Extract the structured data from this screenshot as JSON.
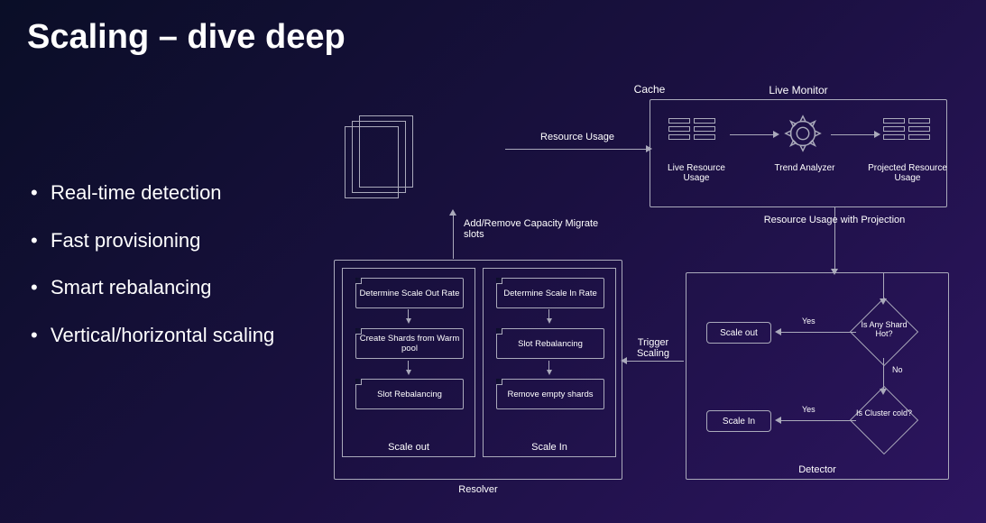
{
  "title": "Scaling – dive deep",
  "bullets": [
    "Real-time detection",
    "Fast provisioning",
    "Smart rebalancing",
    "Vertical/horizontal scaling"
  ],
  "diagram": {
    "cache": {
      "label": "Cache"
    },
    "liveMonitor": {
      "label": "Live Monitor",
      "items": {
        "liveUsage": "Live Resource Usage",
        "trend": "Trend Analyzer",
        "projected": "Projected Resource Usage"
      }
    },
    "edges": {
      "resourceUsage": "Resource Usage",
      "resourceProjection": "Resource Usage with Projection",
      "triggerScaling": "Trigger Scaling",
      "addRemove": "Add/Remove Capacity Migrate slots",
      "yes1": "Yes",
      "no": "No",
      "yes2": "Yes"
    },
    "resolver": {
      "label": "Resolver",
      "scaleOut": {
        "label": "Scale out",
        "steps": [
          "Determine Scale Out Rate",
          "Create Shards from Warm pool",
          "Slot Rebalancing"
        ]
      },
      "scaleIn": {
        "label": "Scale In",
        "steps": [
          "Determine Scale In Rate",
          "Slot Rebalancing",
          "Remove empty shards"
        ]
      }
    },
    "detector": {
      "label": "Detector",
      "decisions": {
        "hot": "Is Any Shard Hot?",
        "cold": "Is Cluster cold?"
      },
      "actions": {
        "scaleOut": "Scale out",
        "scaleIn": "Scale In"
      }
    }
  }
}
